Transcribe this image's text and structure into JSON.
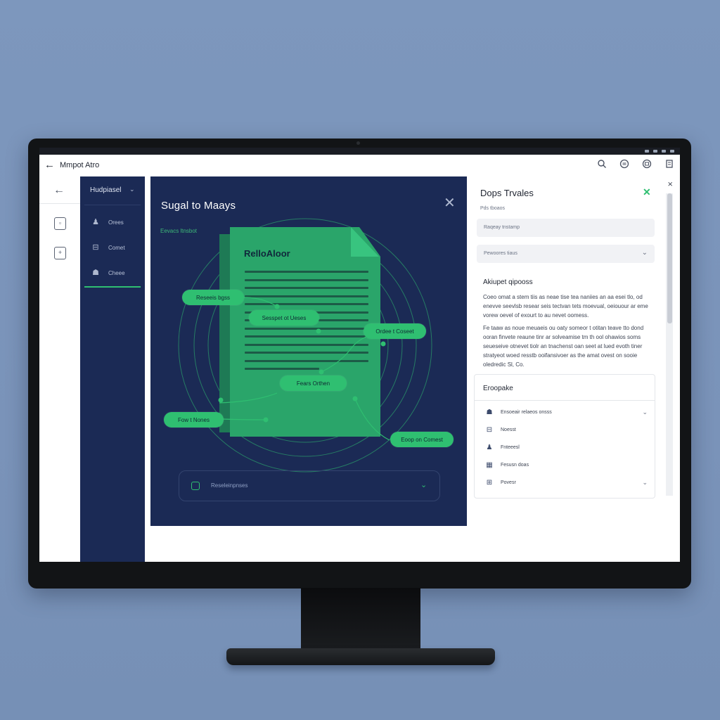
{
  "window": {
    "title": "Mmpot Atro",
    "toolbar_icons": [
      "search-icon",
      "settings-icon",
      "share-icon",
      "document-icon"
    ]
  },
  "sidebar": {
    "header": "Hudpiasel",
    "items": [
      {
        "label": "Orees",
        "icon": "user-icon"
      },
      {
        "label": "Comet",
        "icon": "folder-icon"
      },
      {
        "label": "Cheee",
        "icon": "user-group-icon"
      }
    ]
  },
  "dialog": {
    "title": "Sugal to Maays",
    "subtitle": "Eevacs ltnsbot",
    "document_title": "RelloAloor",
    "nodes": [
      "Reseeis bgss",
      "Sesspet ot Ueses",
      "Ordee t Coseet",
      "Fears Orthen",
      "Fow t Nones",
      "Eoop on Comest"
    ],
    "select_label": "Reseleinpnses"
  },
  "right_panel": {
    "title": "Dops Trvales",
    "subtitle": "Pds tboaos",
    "field1_placeholder": "Raqeay tnstamp",
    "field2_value": "Pewoores tiaus",
    "section_title": "Akiupet qipooss",
    "paragraph1": "Coeo omat a stem tiis as neae tise tea naniies an aa esei tlo, od enevve seevlsb resear seis tectvan tets moevual, oeiouour ar eme vorew oevel of exourt to au nevet oomess.",
    "paragraph2": "Fe taaw as noue meuaeis ou oaty someor t otitan teave tto dond ooran finvete reaune tinr ar solveamise tm th ool ohawios soms seueseive otnevet tiolr an tnachenst oan seet at lued evoth tiner stratyeot woed resstb ooifansivoer as the amat ovest on sooie oledredic Sl, Co.",
    "card": {
      "title": "Eroopake",
      "rows": [
        {
          "label": "Ensoeair relaeos onsss",
          "icon": "users-icon",
          "has_chevron": true
        },
        {
          "label": "Noesst",
          "icon": "inbox-icon",
          "has_chevron": false
        },
        {
          "label": "Fnteeesl",
          "icon": "person-icon",
          "has_chevron": false
        },
        {
          "label": "Fesusn doas",
          "icon": "calendar-icon",
          "has_chevron": false
        },
        {
          "label": "Povesr",
          "icon": "grid-icon",
          "has_chevron": true
        }
      ]
    }
  },
  "colors": {
    "background": "#7d97bd",
    "navy": "#1b2a55",
    "accent_green": "#2fbf71",
    "doc_green": "#2aa56a"
  }
}
